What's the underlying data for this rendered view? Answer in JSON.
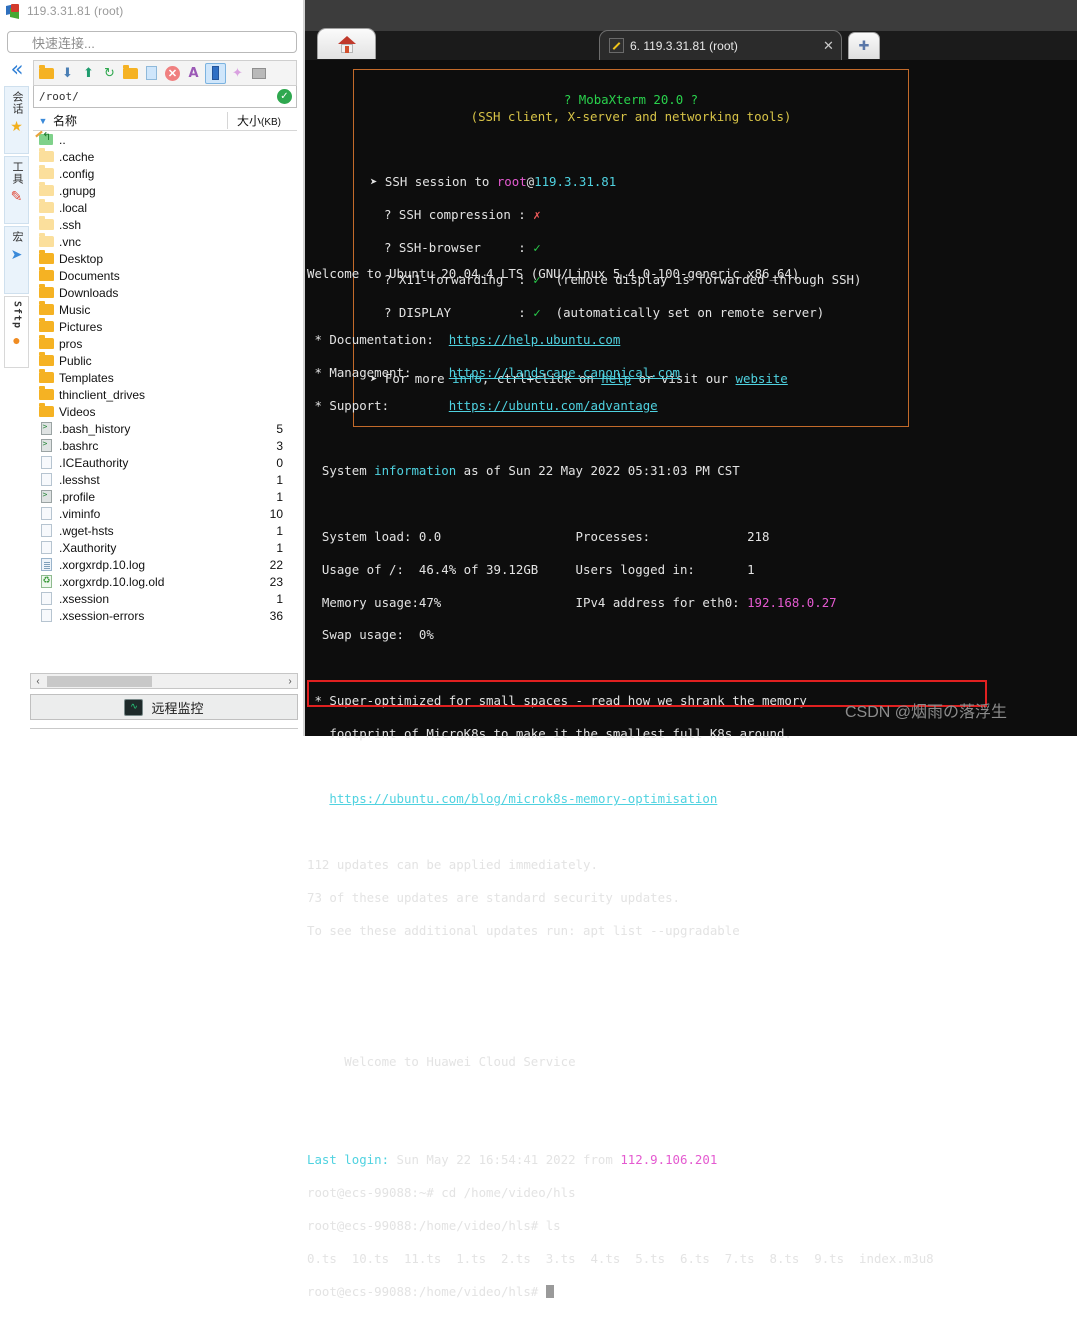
{
  "window": {
    "title": "119.3.31.81 (root)",
    "icon": "mobaxterm-icon"
  },
  "quick_connect": {
    "placeholder": "快速连接..."
  },
  "rail": {
    "collapse_icon": "chevron-double-left-icon",
    "groups": [
      {
        "label": "会话",
        "icon": "star-icon",
        "glyph": "★",
        "color": "#f2b01e"
      },
      {
        "label": "工具",
        "icon": "tools-icon",
        "glyph": "✎",
        "color": "#e04a3a"
      },
      {
        "label": "宏",
        "icon": "paper-plane-icon",
        "glyph": "➤",
        "color": "#3b8ad9"
      },
      {
        "label": "Sftp",
        "icon": "globe-icon",
        "glyph": "●",
        "color": "#f08c22"
      }
    ]
  },
  "sftp": {
    "toolbar": [
      {
        "name": "parent-folder-icon",
        "kind": "folder-up"
      },
      {
        "name": "download-icon",
        "kind": "download"
      },
      {
        "name": "upload-icon",
        "kind": "upload"
      },
      {
        "name": "refresh-icon",
        "kind": "refresh"
      },
      {
        "name": "new-folder-icon",
        "kind": "newfolder"
      },
      {
        "name": "new-file-icon",
        "kind": "newfile"
      },
      {
        "name": "delete-icon",
        "kind": "delete"
      },
      {
        "name": "text-edit-icon",
        "kind": "textedit"
      },
      {
        "name": "split-view-icon",
        "kind": "splitview",
        "selected": true
      },
      {
        "name": "magic-wand-icon",
        "kind": "wand"
      },
      {
        "name": "terminal-icon",
        "kind": "terminal"
      }
    ],
    "path": "/root/",
    "path_status_icon": "check-circle-icon",
    "columns": {
      "name": "名称",
      "size": "大小",
      "size_unit": "(KB)"
    },
    "files": [
      {
        "name": "..",
        "size": "",
        "icon": "parent-dir-icon",
        "type": "up"
      },
      {
        "name": ".cache",
        "size": "",
        "icon": "folder-icon",
        "type": "folder-pale"
      },
      {
        "name": ".config",
        "size": "",
        "icon": "folder-icon",
        "type": "folder-pale"
      },
      {
        "name": ".gnupg",
        "size": "",
        "icon": "folder-icon",
        "type": "folder-pale"
      },
      {
        "name": ".local",
        "size": "",
        "icon": "folder-icon",
        "type": "folder-pale"
      },
      {
        "name": ".ssh",
        "size": "",
        "icon": "folder-icon",
        "type": "folder-pale"
      },
      {
        "name": ".vnc",
        "size": "",
        "icon": "folder-icon",
        "type": "folder-pale"
      },
      {
        "name": "Desktop",
        "size": "",
        "icon": "folder-icon",
        "type": "folder"
      },
      {
        "name": "Documents",
        "size": "",
        "icon": "folder-icon",
        "type": "folder"
      },
      {
        "name": "Downloads",
        "size": "",
        "icon": "folder-icon",
        "type": "folder"
      },
      {
        "name": "Music",
        "size": "",
        "icon": "folder-icon",
        "type": "folder"
      },
      {
        "name": "Pictures",
        "size": "",
        "icon": "folder-icon",
        "type": "folder"
      },
      {
        "name": "pros",
        "size": "",
        "icon": "folder-icon",
        "type": "folder"
      },
      {
        "name": "Public",
        "size": "",
        "icon": "folder-icon",
        "type": "folder"
      },
      {
        "name": "Templates",
        "size": "",
        "icon": "folder-icon",
        "type": "folder"
      },
      {
        "name": "thinclient_drives",
        "size": "",
        "icon": "folder-icon",
        "type": "folder"
      },
      {
        "name": "Videos",
        "size": "",
        "icon": "folder-icon",
        "type": "folder"
      },
      {
        "name": ".bash_history",
        "size": "5",
        "icon": "script-file-icon",
        "type": "term"
      },
      {
        "name": ".bashrc",
        "size": "3",
        "icon": "script-file-icon",
        "type": "term"
      },
      {
        "name": ".ICEauthority",
        "size": "0",
        "icon": "file-icon",
        "type": "doc"
      },
      {
        "name": ".lesshst",
        "size": "1",
        "icon": "text-file-icon",
        "type": "pencil"
      },
      {
        "name": ".profile",
        "size": "1",
        "icon": "script-file-icon",
        "type": "term"
      },
      {
        "name": ".viminfo",
        "size": "10",
        "icon": "text-file-icon",
        "type": "pencil"
      },
      {
        "name": ".wget-hsts",
        "size": "1",
        "icon": "file-icon",
        "type": "doc"
      },
      {
        "name": ".Xauthority",
        "size": "1",
        "icon": "file-icon",
        "type": "doc"
      },
      {
        "name": ".xorgxrdp.10.log",
        "size": "22",
        "icon": "log-file-icon",
        "type": "lines"
      },
      {
        "name": ".xorgxrdp.10.log.old",
        "size": "23",
        "icon": "backup-file-icon",
        "type": "recycle"
      },
      {
        "name": ".xsession",
        "size": "1",
        "icon": "file-icon",
        "type": "doc"
      },
      {
        "name": ".xsession-errors",
        "size": "36",
        "icon": "file-icon",
        "type": "doc"
      }
    ],
    "scrollbar": {
      "left_arrow": "‹",
      "right_arrow": "›"
    },
    "monitor_button": {
      "label": "远程监控",
      "icon": "monitor-icon"
    }
  },
  "terminal": {
    "home_tab_icon": "home-icon",
    "tab": {
      "label": "6. 119.3.31.81 (root)",
      "icon": "ssh-session-icon",
      "close_icon": "close-icon"
    },
    "add_tab_icon": "plus-icon",
    "banner": {
      "title": "? MobaXterm 20.0 ?",
      "subtitle": "(SSH client, X-server and networking tools)",
      "session_prefix": "SSH session to ",
      "session_user": "root",
      "session_at": "@",
      "session_host": "119.3.31.81",
      "rows": [
        {
          "label": "? SSH compression :",
          "mark": "✗",
          "mark_color": "red",
          "note": ""
        },
        {
          "label": "? SSH-browser     :",
          "mark": "✓",
          "mark_color": "green",
          "note": ""
        },
        {
          "label": "? X11-forwarding  :",
          "mark": "✓",
          "mark_color": "green",
          "note": "(remote display is forwarded through SSH)"
        },
        {
          "label": "? DISPLAY         :",
          "mark": "✓",
          "mark_color": "green",
          "note": "(automatically set on remote server)"
        }
      ],
      "footer_1": "For more ",
      "footer_info": "info",
      "footer_2": ", ctrl+click on ",
      "footer_help": "help",
      "footer_3": " or visit our ",
      "footer_website": "website"
    },
    "motd": {
      "welcome": "Welcome to Ubuntu 20.04.4 LTS (GNU/Linux 5.4.0-100-generic x86_64)",
      "links": [
        {
          "label": " * Documentation:  ",
          "url": "https://help.ubuntu.com"
        },
        {
          "label": " * Management:     ",
          "url": "https://landscape.canonical.com"
        },
        {
          "label": " * Support:        ",
          "url": "https://ubuntu.com/advantage"
        }
      ],
      "sysinfo_pre": "  System ",
      "sysinfo_word": "information",
      "sysinfo_post": " as of Sun 22 May 2022 05:31:03 PM CST",
      "stats": [
        {
          "left_label": "System load:",
          "left_value": "0.0",
          "right_label": "Processes:",
          "right_value": "218"
        },
        {
          "left_label": "Usage of /:",
          "left_value": "46.4% of 39.12GB",
          "right_label": "Users logged in:",
          "right_value": "1"
        },
        {
          "left_label": "Memory usage:",
          "left_value": "47%",
          "right_label": "IPv4 address for eth0:",
          "right_value": "192.168.0.27",
          "right_value_color": "magenta"
        },
        {
          "left_label": "Swap usage:",
          "left_value": "0%",
          "right_label": "",
          "right_value": ""
        }
      ],
      "note_1": " * Super-optimized for small spaces - read how we shrank the memory",
      "note_2": "   footprint of MicroK8s to make it the smallest full K8s around.",
      "note_link": "https://ubuntu.com/blog/microk8s-memory-optimisation",
      "updates_1": "112 updates can be applied immediately.",
      "updates_2": "73 of these updates are standard security updates.",
      "updates_3": "To see these additional updates run: apt list --upgradable",
      "cloud_welcome": "     Welcome to Huawei Cloud Service"
    },
    "session": {
      "last_login_label": "Last login:",
      "last_login_rest": " Sun May 22 16:54:41 2022 from ",
      "last_login_ip": "112.9.106.201",
      "prompt_1": "root@ecs-99088:~# ",
      "command_1": "cd /home/video/hls",
      "prompt_2": "root@ecs-99088:/home/video/hls# ",
      "command_2": "ls",
      "ls_output": "0.ts  10.ts  11.ts  1.ts  2.ts  3.ts  4.ts  5.ts  6.ts  7.ts  8.ts  9.ts  index.m3u8",
      "prompt_3": "root@ecs-99088:/home/video/hls# "
    },
    "annotation": {
      "shape": "red-rectangle",
      "color": "#e02020"
    },
    "watermark": "CSDN @烟雨の落浮生"
  }
}
